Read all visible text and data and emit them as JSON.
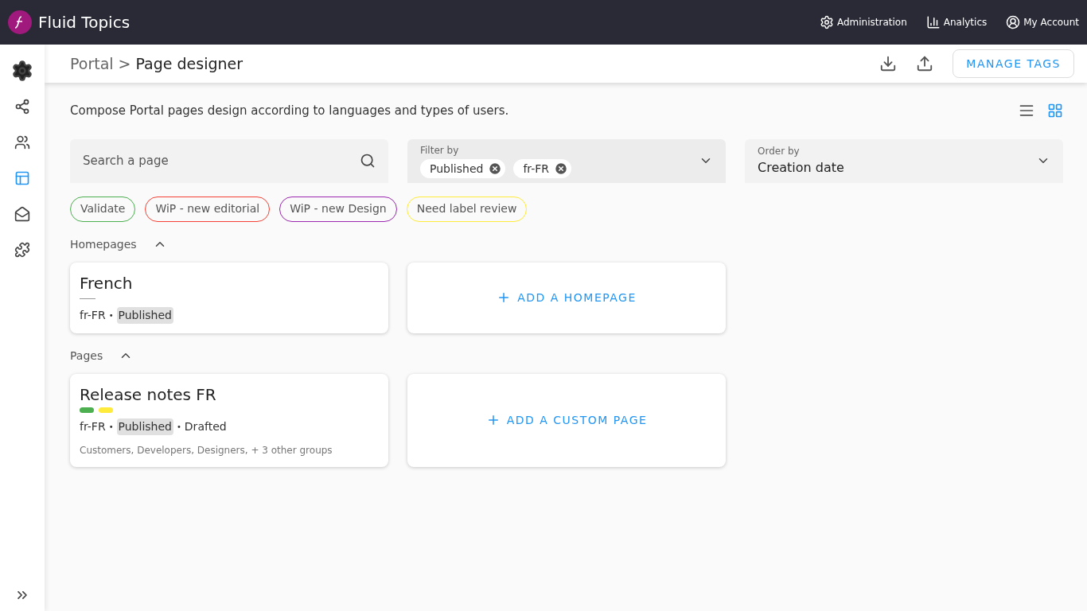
{
  "header": {
    "brand": "Fluid Topics",
    "nav": [
      {
        "kind": "gear",
        "label": "Administration"
      },
      {
        "kind": "chart",
        "label": "Analytics"
      },
      {
        "kind": "account",
        "label": "My Account"
      }
    ]
  },
  "sidebar": {
    "items": [
      {
        "kind": "gear",
        "selected": false
      },
      {
        "kind": "graph",
        "selected": false
      },
      {
        "kind": "users",
        "selected": false
      },
      {
        "kind": "layout",
        "selected": true
      },
      {
        "kind": "mail",
        "selected": false
      },
      {
        "kind": "plugin",
        "selected": false
      }
    ]
  },
  "titlebar": {
    "parent": "Portal",
    "separator": ">",
    "current": "Page designer",
    "button": "MANAGE TAGS"
  },
  "description": "Compose Portal pages design according to languages and types of users.",
  "views": [
    {
      "kind": "list",
      "selected": false
    },
    {
      "kind": "grid",
      "selected": true
    }
  ],
  "search": {
    "placeholder": "Search a page"
  },
  "filter": {
    "label": "Filter by",
    "chips": [
      "Published",
      "fr-FR"
    ]
  },
  "order": {
    "label": "Order by",
    "value": "Creation date"
  },
  "tags": [
    {
      "label": "Validate",
      "color": "#4caf50"
    },
    {
      "label": "WiP - new editorial",
      "color": "#f44336"
    },
    {
      "label": "WiP - new Design",
      "color": "#9c27b0"
    },
    {
      "label": "Need label review",
      "color": "#ffeb3b"
    }
  ],
  "sections": [
    {
      "title": "Homepages",
      "expanded": true,
      "add_label": "ADD A HOMEPAGE",
      "cards": [
        {
          "title": "French",
          "meta": [
            {
              "kind": "plain",
              "text": "fr-FR"
            },
            {
              "kind": "separator",
              "text": "•"
            },
            {
              "kind": "status",
              "text": "Published"
            }
          ]
        }
      ]
    },
    {
      "title": "Pages",
      "expanded": true,
      "add_label": "ADD A CUSTOM PAGE",
      "cards": [
        {
          "title": "Release notes FR",
          "tags": [
            {
              "color": "#4caf50"
            },
            {
              "color": "#ffeb3b"
            }
          ],
          "meta": [
            {
              "kind": "plain",
              "text": "fr-FR"
            },
            {
              "kind": "separator",
              "text": "•"
            },
            {
              "kind": "status",
              "text": "Published"
            },
            {
              "kind": "separator",
              "text": "•"
            },
            {
              "kind": "plain",
              "text": "Drafted"
            }
          ],
          "groups": "Customers, Developers, Designers, + 3 other groups"
        }
      ]
    }
  ]
}
